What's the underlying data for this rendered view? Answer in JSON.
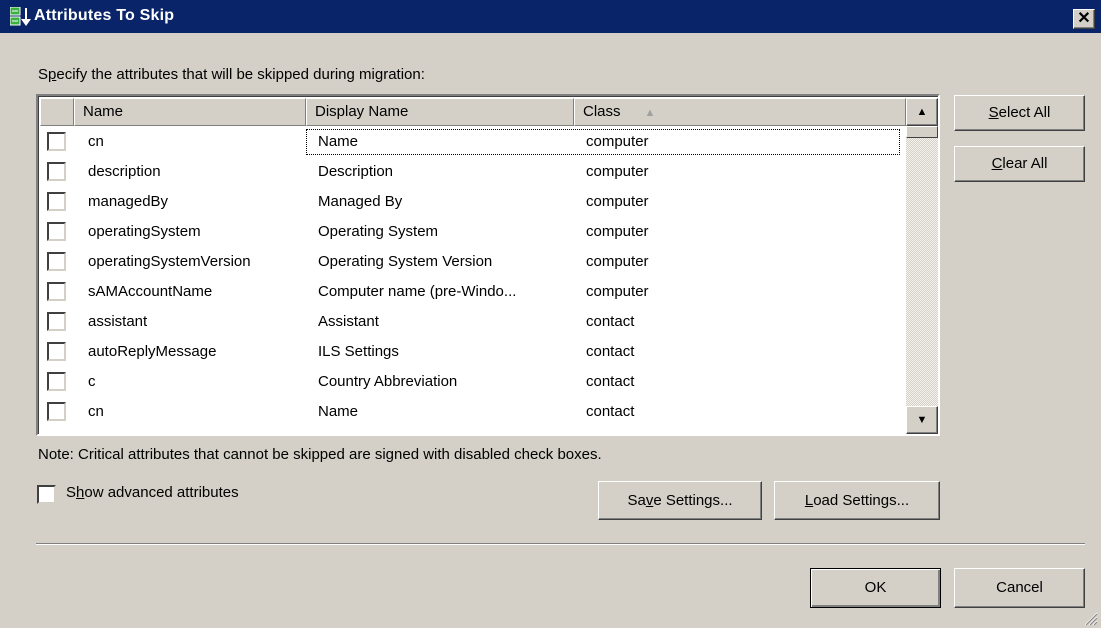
{
  "window": {
    "title": "Attributes To Skip",
    "close_glyph": "✕"
  },
  "instruction": {
    "accel": "p",
    "pre": "S",
    "post": "ecify the attributes that will be skipped during migration:"
  },
  "table": {
    "columns": [
      "Name",
      "Display Name",
      "Class"
    ],
    "sort_glyph": "▲",
    "rows": [
      {
        "name": "cn",
        "display": "Name",
        "class": "computer",
        "checked": false
      },
      {
        "name": "description",
        "display": "Description",
        "class": "computer",
        "checked": false
      },
      {
        "name": "managedBy",
        "display": "Managed By",
        "class": "computer",
        "checked": false
      },
      {
        "name": "operatingSystem",
        "display": "Operating System",
        "class": "computer",
        "checked": false
      },
      {
        "name": "operatingSystemVersion",
        "display": "Operating System Version",
        "class": "computer",
        "checked": false
      },
      {
        "name": "sAMAccountName",
        "display": "Computer name (pre-Windo...",
        "class": "computer",
        "checked": false
      },
      {
        "name": "assistant",
        "display": "Assistant",
        "class": "contact",
        "checked": false
      },
      {
        "name": "autoReplyMessage",
        "display": "ILS Settings",
        "class": "contact",
        "checked": false
      },
      {
        "name": "c",
        "display": "Country Abbreviation",
        "class": "contact",
        "checked": false
      },
      {
        "name": "cn",
        "display": "Name",
        "class": "contact",
        "checked": false
      }
    ]
  },
  "buttons": {
    "select_all": {
      "accel": "S",
      "rest": "elect All"
    },
    "clear_all": {
      "accel": "C",
      "rest": "lear All"
    },
    "save_settings": {
      "pre": "Sa",
      "accel": "v",
      "rest": "e Settings..."
    },
    "load_settings": {
      "accel": "L",
      "rest": "oad Settings..."
    },
    "ok": "OK",
    "cancel": "Cancel"
  },
  "note": "Note: Critical attributes that cannot be skipped are signed with disabled check boxes.",
  "advanced": {
    "accel": "h",
    "pre": "S",
    "rest": "ow advanced attributes",
    "checked": false
  },
  "colors": {
    "title_bg": "#0a246a",
    "face": "#d4d0c8"
  }
}
